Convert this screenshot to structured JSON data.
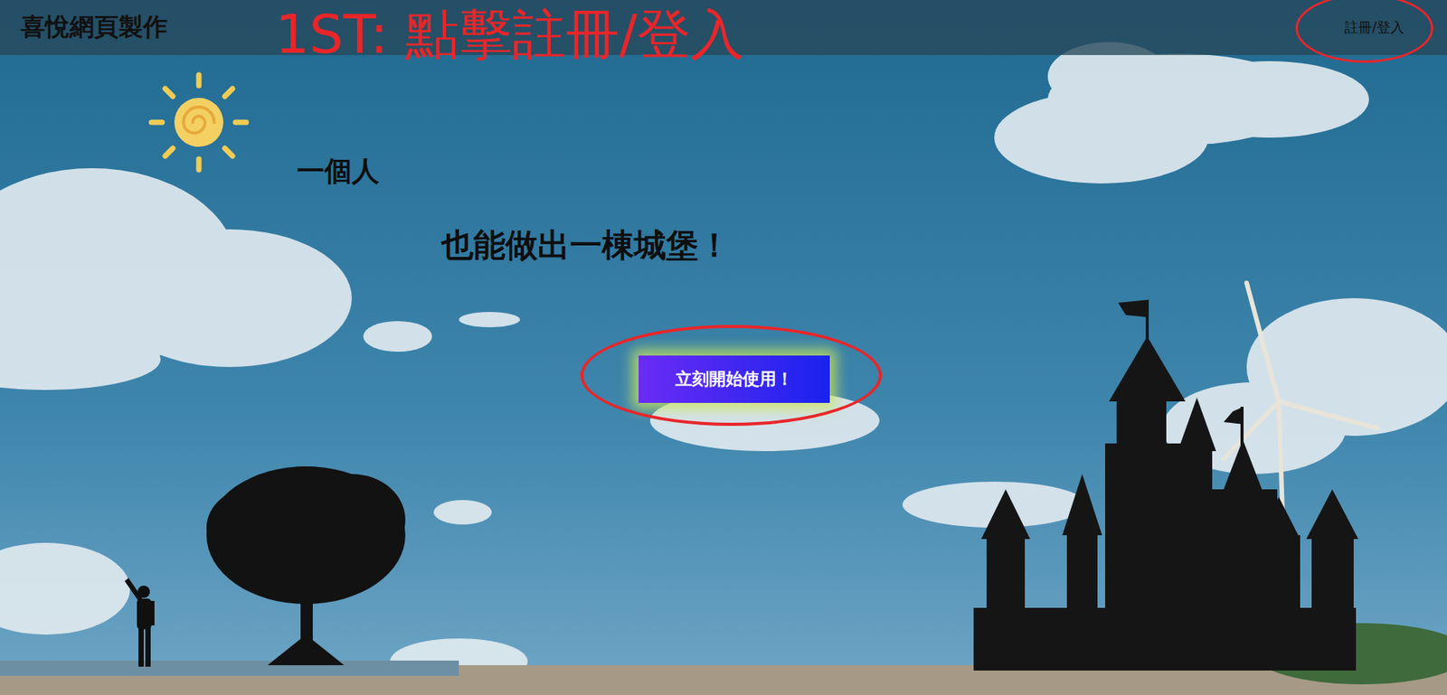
{
  "header": {
    "brand": "喜悅網頁製作",
    "annotation": "1ST: 點擊註冊/登入",
    "auth_link": "註冊/登入"
  },
  "hero": {
    "line1": "一個人",
    "line2": "也能做出一棟城堡！",
    "cta": "立刻開始使用！"
  }
}
